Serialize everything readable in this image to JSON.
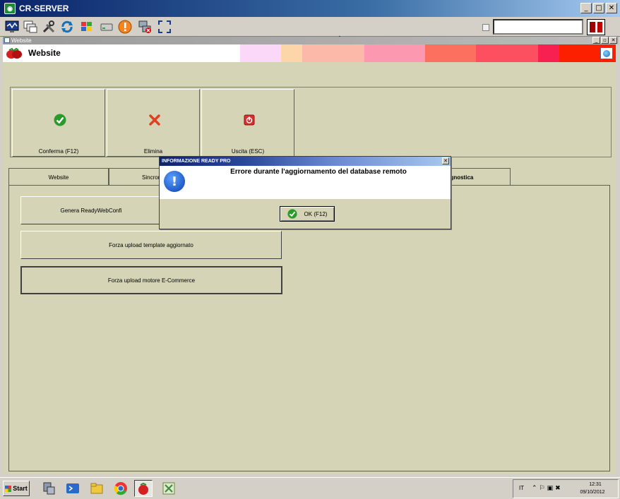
{
  "rdp": {
    "title": "CR-SERVER",
    "window_buttons": [
      "_",
      "□",
      "✕"
    ]
  },
  "toolbar": {
    "icons": [
      "monitor-icon",
      "windows-icon",
      "tools-icon",
      "refresh-icon",
      "windows-logo-icon",
      "drive-icon",
      "alert-icon",
      "network-icon",
      "fullscreen-icon"
    ]
  },
  "mdi": {
    "title": "Website",
    "buttons": [
      "_",
      "▫",
      "✕"
    ]
  },
  "header": {
    "name": "Website",
    "strip_colors": [
      "#fcd8f8",
      "#fcd5a8",
      "#fcb8a8",
      "#fc98b0",
      "#fc7060",
      "#fc5060",
      "#f82050",
      "#fc2000"
    ]
  },
  "panel_buttons": [
    {
      "label": "Conferma (F12)",
      "icon": "check-icon"
    },
    {
      "label": "Elimina",
      "icon": "delete-icon"
    },
    {
      "label": "Uscita (ESC)",
      "icon": "exit-icon"
    }
  ],
  "tabs": [
    {
      "label": "Website"
    },
    {
      "label": "Sincron"
    },
    {
      "label": "agnostica"
    }
  ],
  "pane_buttons": [
    {
      "label": "Genera ReadyWebConfi"
    },
    {
      "label": "Forza upload template aggiornato"
    },
    {
      "label": "Forza upload motore E-Commerce"
    }
  ],
  "dialog": {
    "title": "INFORMAZIONE READY PRO",
    "message": "Errore durante l'aggiornamento del database remoto",
    "ok_label": "OK (F12)"
  },
  "taskbar": {
    "start_label": "Start",
    "lang": "IT",
    "time": "12:31",
    "date": "09/10/2012"
  },
  "colors": {
    "accent": "#0a246a",
    "panel": "#d6d4b6",
    "error_red": "#c00000"
  }
}
